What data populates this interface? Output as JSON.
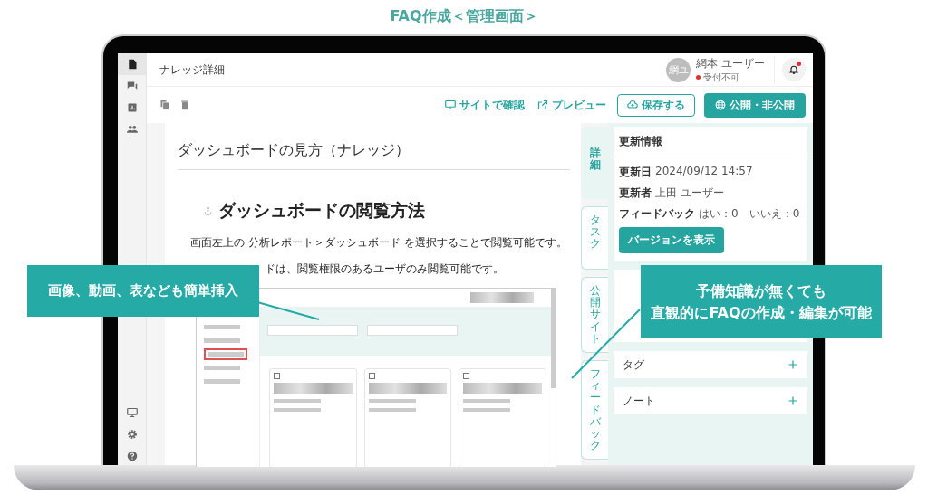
{
  "title": "FAQ作成＜管理画面＞",
  "rail": {
    "items": [
      {
        "kind": "document",
        "selected": true
      },
      {
        "kind": "chat",
        "selected": false
      },
      {
        "kind": "chart",
        "selected": false
      },
      {
        "kind": "people",
        "selected": false
      }
    ],
    "bottom_items": [
      {
        "kind": "monitor",
        "selected": false
      },
      {
        "kind": "settings",
        "selected": false
      },
      {
        "kind": "help",
        "selected": false
      }
    ]
  },
  "header": {
    "page_title": "ナレッジ詳細",
    "user": {
      "avatar": "網ユ",
      "name": "網本 ユーザー",
      "status": "受付不可"
    },
    "notification": {
      "unread": true
    }
  },
  "toolbar": {
    "actions": [
      {
        "kind": "link",
        "label": "サイトで確認"
      },
      {
        "kind": "link",
        "label": "プレビュー"
      },
      {
        "kind": "outline",
        "label": "保存する"
      },
      {
        "kind": "primary",
        "label": "公開・非公開"
      }
    ]
  },
  "article": {
    "title": "ダッシュボードの見方（ナレッジ）",
    "heading": "ダッシュボードの閲覧方法",
    "paragraphs": [
      "画面左上の 分析レポート＞ダッシュボード を選択することで閲覧可能です。",
      "ドは、閲覧権限のあるユーザのみ閲覧可能です。"
    ]
  },
  "side_tabs": [
    {
      "label": "詳細",
      "selected": true
    },
    {
      "label": "タスク",
      "selected": false
    },
    {
      "label": "公開サイト",
      "selected": false
    },
    {
      "label": "フィードバック",
      "selected": false
    }
  ],
  "panel": {
    "update_info": {
      "title": "更新情報",
      "rows": [
        {
          "label": "更新日",
          "values": [
            "2024/09/12 14:57"
          ]
        },
        {
          "label": "更新者",
          "values": [
            "上田 ユーザー"
          ]
        },
        {
          "label": "フィードバック",
          "values": [
            "はい：0",
            "いいえ：0"
          ]
        }
      ],
      "button": "バージョンを表示"
    },
    "sections": [
      {
        "title": "タグ"
      },
      {
        "title": "ノート"
      }
    ]
  },
  "callouts": [
    {
      "lines": [
        "画像、動画、表なども簡単挿入"
      ]
    },
    {
      "lines": [
        "予備知識が無くても",
        "直観的にFAQの作成・編集が可能"
      ]
    }
  ]
}
